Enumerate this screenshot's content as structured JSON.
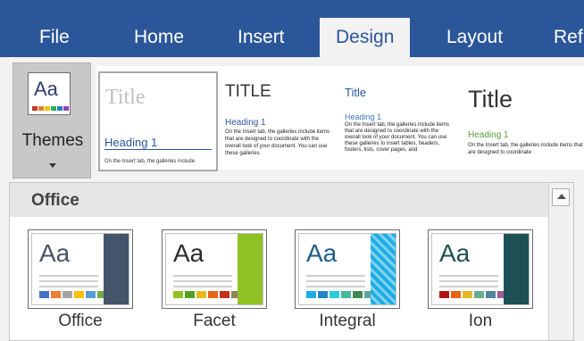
{
  "tabs": [
    {
      "label": "File",
      "active": false
    },
    {
      "label": "Home",
      "active": false
    },
    {
      "label": "Insert",
      "active": false
    },
    {
      "label": "Design",
      "active": true
    },
    {
      "label": "Layout",
      "active": false
    },
    {
      "label": "Ref",
      "active": false
    }
  ],
  "themes_button": {
    "label": "Themes",
    "icon_text": "Aa",
    "icon_swatches": [
      "#c0392b",
      "#e67e22",
      "#f1c40f",
      "#27ae60",
      "#2980b9",
      "#8e44ad",
      "#7f8c8d"
    ]
  },
  "style_set": [
    {
      "title": "Title",
      "heading": "Heading 1",
      "body": "On the Insert tab, the galleries include"
    },
    {
      "title": "TITLE",
      "heading": "Heading 1",
      "body": "On the Insert tab, the galleries include items that are designed to coordinate with the overall look of your document. You can use these galleries"
    },
    {
      "title": "Title",
      "heading": "Heading 1",
      "body": "On the Insert tab, the galleries include items that are designed to coordinate with the overall look of your document. You can use these galleries to insert tables, headers, footers, lists, cover pages, and"
    },
    {
      "title": "Title",
      "heading": "Heading 1",
      "body": "On the Insert tab, the galleries include items that are designed to coordinate"
    }
  ],
  "gallery": {
    "section_label": "Office",
    "themes": [
      {
        "name": "Office",
        "aa": "Aa",
        "aa_color": "#44546a",
        "accent": "#44546a",
        "swatches": [
          "#4472c4",
          "#ed7d31",
          "#a5a5a5",
          "#ffc000",
          "#5b9bd5",
          "#70ad47"
        ]
      },
      {
        "name": "Facet",
        "aa": "Aa",
        "aa_color": "#2c2c2c",
        "accent": "#90c226",
        "swatches": [
          "#90c226",
          "#54a021",
          "#e6b91e",
          "#e76618",
          "#c42f1a",
          "#918655"
        ]
      },
      {
        "name": "Integral",
        "aa": "Aa",
        "aa_color": "#1f5b8c",
        "accent": "#1cade4",
        "swatches": [
          "#1cade4",
          "#2683c6",
          "#27ced7",
          "#42ba97",
          "#3e8853",
          "#62a39f"
        ]
      },
      {
        "name": "Ion",
        "aa": "Aa",
        "aa_color": "#1e5155",
        "accent": "#1e5155",
        "swatches": [
          "#b01513",
          "#ea6312",
          "#e6b729",
          "#6aac90",
          "#54849a",
          "#9e5e9b"
        ]
      }
    ]
  }
}
